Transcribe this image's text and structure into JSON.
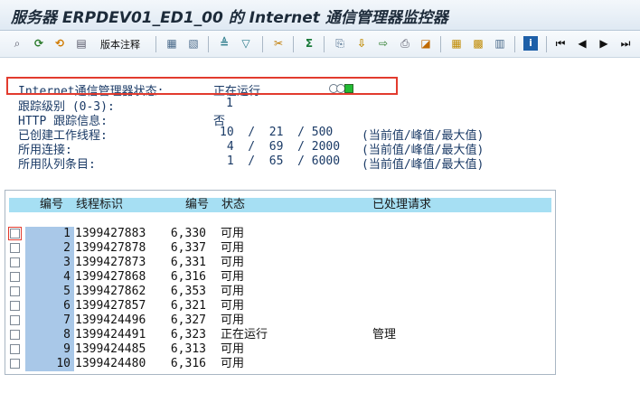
{
  "title": "服务器 ERPDEV01_ED1_00 的 Internet 通信管理器监控器",
  "toolbar": {
    "version_label": "版本注释",
    "icons": [
      "glasses-icon",
      "refresh-icon",
      "refresh-alt-icon",
      "server-icon",
      "version-notes",
      "details-icon",
      "details-alt-icon",
      "sort-asc-icon",
      "filter-icon",
      "cut-icon",
      "sum-icon",
      "export-icon",
      "download-icon",
      "send-icon",
      "print-icon",
      "layout-icon",
      "grid-icon",
      "select-all-icon",
      "columns-icon",
      "info-icon",
      "first-page-icon",
      "prev-page-icon",
      "next-page-icon",
      "last-page-icon"
    ]
  },
  "status": {
    "icm_status_label": "Internet通信管理器状态:",
    "icm_status_value": "正在运行",
    "trace_level_label": "跟踪级别 (0-3):",
    "trace_level_value": "1",
    "http_trace_label": "HTTP 跟踪信息:",
    "http_trace_value": "否",
    "threads_label": "已创建工作线程:",
    "threads_values": "10  /  21  / 500",
    "threads_note": "(当前值/峰值/最大值)",
    "connections_label": "所用连接:",
    "connections_values": " 4  /  69  / 2000",
    "connections_note": "(当前值/峰值/最大值)",
    "queue_label": "所用队列条目:",
    "queue_values": " 1  /  65  / 6000",
    "queue_note": "(当前值/峰值/最大值)"
  },
  "table": {
    "headers": {
      "no": "编号",
      "thread_id": "线程标识",
      "pid": "编号",
      "status": "状态",
      "processed": "已处理请求"
    },
    "rows": [
      {
        "no": "1",
        "thread_id": "1399427883",
        "pid": "6,330",
        "status": "可用",
        "processed": ""
      },
      {
        "no": "2",
        "thread_id": "1399427878",
        "pid": "6,337",
        "status": "可用",
        "processed": ""
      },
      {
        "no": "3",
        "thread_id": "1399427873",
        "pid": "6,331",
        "status": "可用",
        "processed": ""
      },
      {
        "no": "4",
        "thread_id": "1399427868",
        "pid": "6,316",
        "status": "可用",
        "processed": ""
      },
      {
        "no": "5",
        "thread_id": "1399427862",
        "pid": "6,353",
        "status": "可用",
        "processed": ""
      },
      {
        "no": "6",
        "thread_id": "1399427857",
        "pid": "6,321",
        "status": "可用",
        "processed": ""
      },
      {
        "no": "7",
        "thread_id": "1399424496",
        "pid": "6,327",
        "status": "可用",
        "processed": ""
      },
      {
        "no": "8",
        "thread_id": "1399424491",
        "pid": "6,323",
        "status": "正在运行",
        "processed": "管理"
      },
      {
        "no": "9",
        "thread_id": "1399424485",
        "pid": "6,313",
        "status": "可用",
        "processed": ""
      },
      {
        "no": "10",
        "thread_id": "1399424480",
        "pid": "6,316",
        "status": "可用",
        "processed": ""
      }
    ]
  },
  "colors": {
    "header_bg": "#a6dff3",
    "number_bg": "#a9c8e8",
    "highlight_border": "#e23b2e",
    "text_blue": "#1a3a66"
  }
}
